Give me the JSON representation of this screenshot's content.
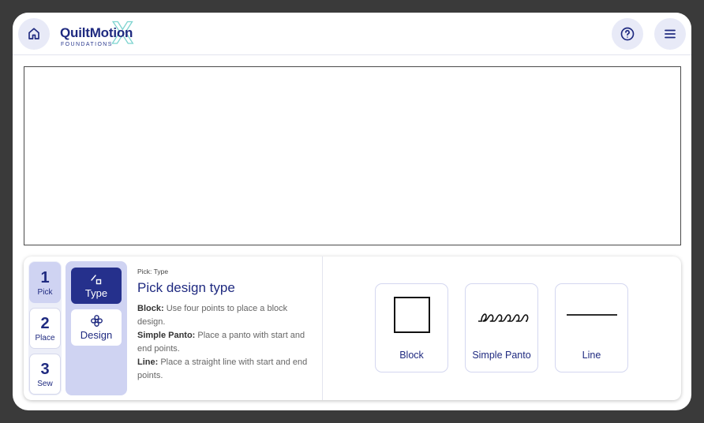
{
  "app": {
    "logo_title": "QuiltMotion",
    "logo_subtitle": "FOUNDATIONS",
    "logo_mark": "X"
  },
  "header": {
    "home_icon": "home-icon",
    "help_icon": "help-circle-icon",
    "menu_icon": "hamburger-menu-icon"
  },
  "steps": [
    {
      "number": "1",
      "label": "Pick",
      "active": true
    },
    {
      "number": "2",
      "label": "Place",
      "active": false
    },
    {
      "number": "3",
      "label": "Sew",
      "active": false
    }
  ],
  "subnav": [
    {
      "label": "Type",
      "icon": "shape-type-icon",
      "active": true
    },
    {
      "label": "Design",
      "icon": "flower-icon",
      "active": false
    }
  ],
  "description": {
    "breadcrumb": "Pick: Type",
    "title": "Pick design type",
    "items": [
      {
        "term": "Block:",
        "text": "Use four points to place a block design."
      },
      {
        "term": "Simple Panto:",
        "text": "Place a panto with start and end points."
      },
      {
        "term": "Line:",
        "text": "Place a straight line with start and end points."
      }
    ]
  },
  "design_types": [
    {
      "label": "Block",
      "icon": "square-block-icon"
    },
    {
      "label": "Simple Panto",
      "icon": "loop-panto-icon"
    },
    {
      "label": "Line",
      "icon": "straight-line-icon"
    }
  ],
  "colors": {
    "primary": "#25308c",
    "accent_light": "#cfd3f2",
    "logo_accent": "#7fd4d0"
  }
}
